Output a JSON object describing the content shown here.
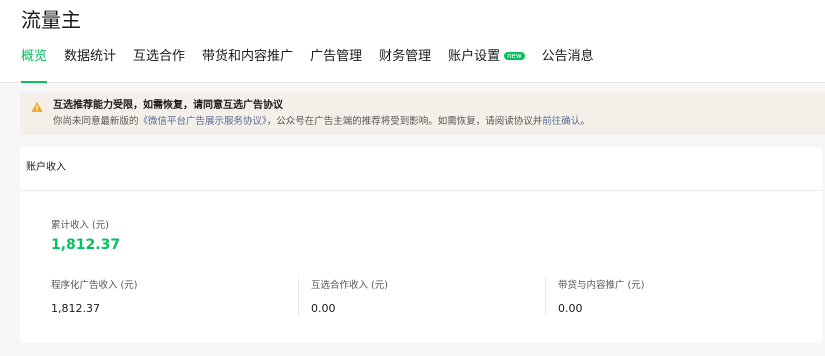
{
  "app": {
    "title": "流量主"
  },
  "tabs": [
    {
      "label": "概览",
      "active": true
    },
    {
      "label": "数据统计"
    },
    {
      "label": "互选合作"
    },
    {
      "label": "带货和内容推广"
    },
    {
      "label": "广告管理"
    },
    {
      "label": "财务管理"
    },
    {
      "label": "账户设置",
      "badge": "new"
    },
    {
      "label": "公告消息"
    }
  ],
  "notice": {
    "icon": "warning-icon",
    "title": "互选推荐能力受限，如需恢复，请同意互选广告协议",
    "body_prefix": "你尚未同意最新版的",
    "agreement_link": "《微信平台广告展示服务协议》",
    "body_middle": "，公众号在广告主端的推荐将受到影响。如需恢复，请阅读协议并",
    "action_link": "前往确认",
    "body_suffix": "。"
  },
  "income": {
    "card_title": "账户收入",
    "total_label": "累计收入 (元)",
    "total_value": "1,812.37",
    "breakdown": [
      {
        "label": "程序化广告收入 (元)",
        "value": "1,812.37"
      },
      {
        "label": "互选合作收入 (元)",
        "value": "0.00"
      },
      {
        "label": "带货与内容推广 (元)",
        "value": "0.00"
      }
    ]
  },
  "colors": {
    "accent": "#07c160",
    "link": "#576b95",
    "warning": "#f5a623",
    "notice_bg": "#f4f0e9"
  }
}
